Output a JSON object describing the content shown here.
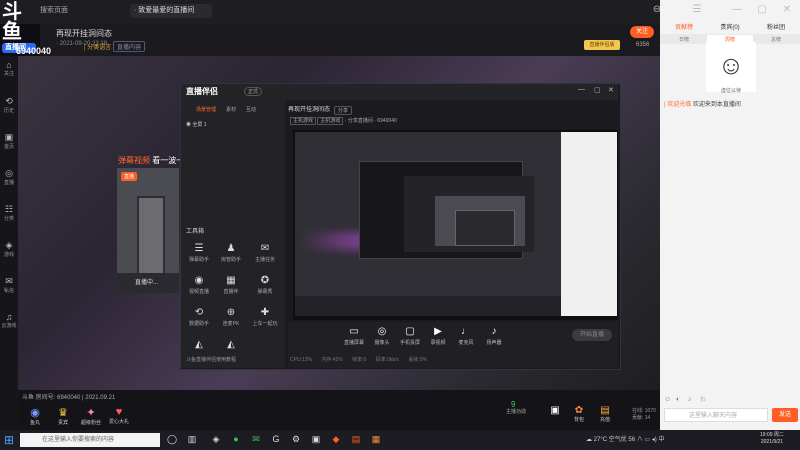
{
  "app": {
    "logo_main": "斗鱼",
    "logo_sub": "直播间"
  },
  "tabs": [
    {
      "label": "搜索页面"
    },
    {
      "label": "· 致爱最爱的直播间"
    }
  ],
  "window_controls": [
    "⊖",
    "♡",
    "☰",
    "—",
    "▢",
    "✕"
  ],
  "room": {
    "title": "再现开挂洞间态",
    "meta": "· 2021-09-20 23:19",
    "room_id": "6940040",
    "tag": "| 分类语言",
    "tag_button": "直播内容",
    "follow_label": "关注",
    "follow_count": "6356",
    "medal_label": "直播伴侣版"
  },
  "left_nav": [
    {
      "icon": "⌂",
      "label": "关注"
    },
    {
      "icon": "⟲",
      "label": "历史"
    },
    {
      "icon": "▣",
      "label": "首页"
    },
    {
      "icon": "◎",
      "label": "直播"
    },
    {
      "icon": "☷",
      "label": "分类"
    },
    {
      "icon": "◈",
      "label": "游戏"
    },
    {
      "icon": "✉",
      "label": "私信"
    },
    {
      "icon": "♫",
      "label": "云游戏"
    }
  ],
  "overlay": {
    "highlight": "弹幕视频",
    "text": " 看一波一一",
    "pip_badge": "直播",
    "pip_caption": "直播中..."
  },
  "bottom": {
    "info": "斗鱼 房间号: 6940040 | 2021.09.21",
    "gifts": [
      {
        "icon": "◉",
        "label": "鱼丸"
      },
      {
        "icon": "♛",
        "label": "贵宾"
      },
      {
        "icon": "✦",
        "label": "超级粉丝"
      },
      {
        "icon": "♥",
        "label": "爱心大礼"
      }
    ],
    "fish_label": "主播功勋",
    "fish_num": "9",
    "icons": [
      {
        "icon": "▣",
        "label": "礼物"
      },
      {
        "icon": "✿",
        "label": "背包"
      },
      {
        "icon": "▤",
        "label": "充值"
      },
      {
        "icon": "◐",
        "label": "任务"
      }
    ],
    "stat_line1": "在线: 1070",
    "stat_line2": "贡献: 14"
  },
  "right_panel": {
    "tabs": [
      "贡献榜",
      "贵宾(0)",
      "粉丝团"
    ],
    "subtabs": [
      "日榜",
      "周榜",
      "总榜"
    ],
    "avatar_char": "☺",
    "avatar_name": "虚位以待",
    "chat_user": "| 欢迎光临",
    "chat_text": " 欢迎来到本直播间",
    "input_placeholder": "这里输入聊天内容",
    "send_label": "发送",
    "tool_icons": [
      "☺",
      "◐",
      "♪",
      "⚐"
    ]
  },
  "companion": {
    "logo": "直播伴侣",
    "version": "正式",
    "left_tabs": [
      "场景管理",
      "素材",
      "互动"
    ],
    "scene_item": "全屏 1",
    "tools_title": "工具箱",
    "tools": [
      {
        "icon": "☰",
        "label": "弹幕助手"
      },
      {
        "icon": "♟",
        "label": "房管助手"
      },
      {
        "icon": "✉",
        "label": "主播任务"
      },
      {
        "icon": "◉",
        "label": "视频直播"
      },
      {
        "icon": "▦",
        "label": "直播伴"
      },
      {
        "icon": "✪",
        "label": "弹幕秀"
      },
      {
        "icon": "⟲",
        "label": "数据助手"
      },
      {
        "icon": "⊕",
        "label": "连麦PK"
      },
      {
        "icon": "✚",
        "label": "上车一起玩"
      },
      {
        "icon": "◭",
        "label": "更多"
      },
      {
        "icon": "◭",
        "label": "更多"
      }
    ],
    "notice": "斗鱼直播伴侣使用教程",
    "room_title": "再现开挂洞间态",
    "share_label": "分享",
    "room_meta": "· 分享直播间 · 6940040",
    "scene_chip1": "主机游戏",
    "scene_chip2": "主机游戏",
    "controls": [
      {
        "icon": "▭",
        "label": "直播屏幕"
      },
      {
        "icon": "◎",
        "label": "摄像头"
      },
      {
        "icon": "▢",
        "label": "手机投屏"
      },
      {
        "icon": "▶",
        "label": "录视频"
      },
      {
        "icon": "♩",
        "label": "麦克风"
      },
      {
        "icon": "♪",
        "label": "扬声器"
      }
    ],
    "go_live": "开始直播",
    "stats": "CPU:13% 内存:42% 帧率:0 码率:0kb/s 丢帧:0%"
  },
  "taskbar": {
    "start_icon": "⊞",
    "search_placeholder": "在这里输入你要搜索的内容",
    "tray": "☁ 27°C 空气优 56  ∧  ▭  ◂)  中",
    "time": "19:09 周二",
    "date": "2021/9/21",
    "apps": [
      "◯",
      "▥",
      "◈",
      "●",
      "✉",
      "G",
      "⚙",
      "▣",
      "◆",
      "▤",
      "▦"
    ]
  }
}
